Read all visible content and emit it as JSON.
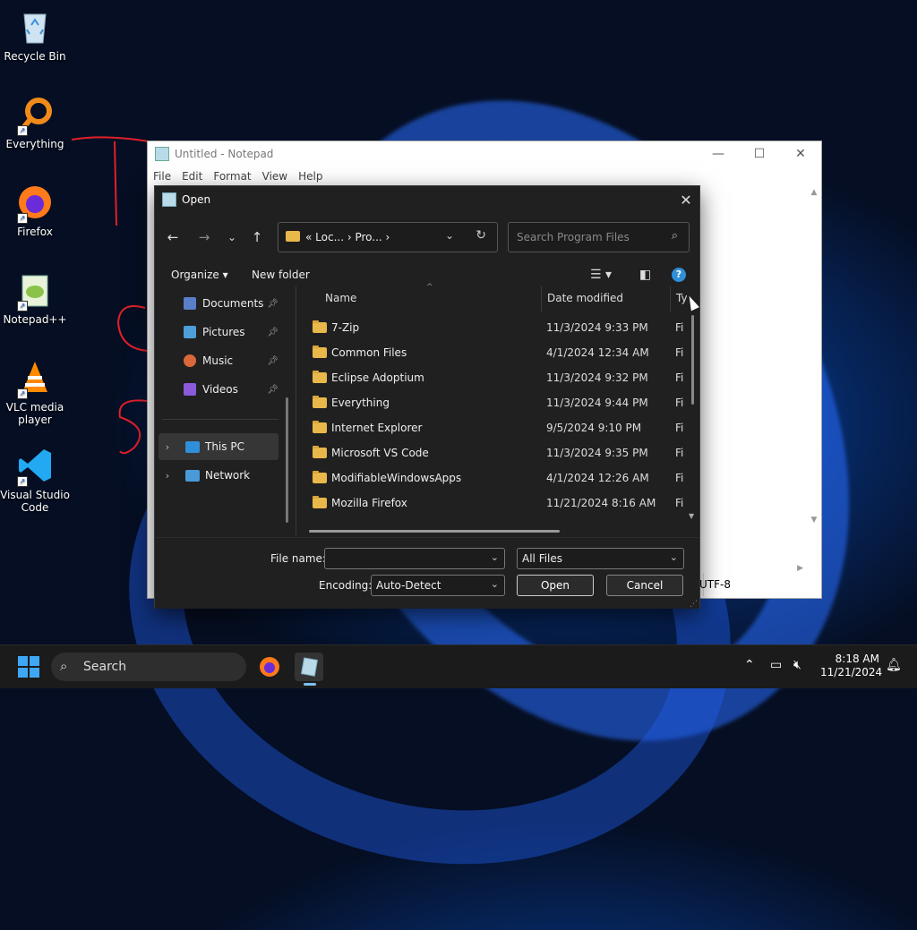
{
  "desktop": {
    "icons": [
      {
        "label": "Recycle Bin"
      },
      {
        "label": "Everything"
      },
      {
        "label": "Firefox"
      },
      {
        "label": "Notepad++"
      },
      {
        "label": "VLC media player"
      },
      {
        "label": "Visual Studio Code"
      }
    ]
  },
  "notepad": {
    "title": "Untitled - Notepad",
    "menu": [
      "File",
      "Edit",
      "Format",
      "View",
      "Help"
    ],
    "encoding_status": "UTF-8"
  },
  "dialog": {
    "title": "Open",
    "address": {
      "breadcrumb": "« Loc... › Pro... ›"
    },
    "search_placeholder": "Search Program Files",
    "organize_label": "Organize ▾",
    "new_folder_label": "New folder",
    "nav_items": [
      {
        "label": "Documents",
        "color": "#5a7fc9"
      },
      {
        "label": "Pictures",
        "color": "#4d9fd9"
      },
      {
        "label": "Music",
        "color": "#d9693a"
      },
      {
        "label": "Videos",
        "color": "#8a5ad9"
      }
    ],
    "tree": [
      {
        "label": "This PC",
        "selected": true
      },
      {
        "label": "Network",
        "selected": false
      }
    ],
    "columns": {
      "name": "Name",
      "date": "Date modified",
      "type": "Ty"
    },
    "rows": [
      {
        "name": "7-Zip",
        "date": "11/3/2024 9:33 PM",
        "type": "Fi"
      },
      {
        "name": "Common Files",
        "date": "4/1/2024 12:34 AM",
        "type": "Fi"
      },
      {
        "name": "Eclipse Adoptium",
        "date": "11/3/2024 9:32 PM",
        "type": "Fi"
      },
      {
        "name": "Everything",
        "date": "11/3/2024 9:44 PM",
        "type": "Fi"
      },
      {
        "name": "Internet Explorer",
        "date": "9/5/2024 9:10 PM",
        "type": "Fi"
      },
      {
        "name": "Microsoft VS Code",
        "date": "11/3/2024 9:35 PM",
        "type": "Fi"
      },
      {
        "name": "ModifiableWindowsApps",
        "date": "4/1/2024 12:26 AM",
        "type": "Fi"
      },
      {
        "name": "Mozilla Firefox",
        "date": "11/21/2024 8:16 AM",
        "type": "Fi"
      }
    ],
    "file_name_label": "File name:",
    "file_name_value": "",
    "file_type_value": "All Files",
    "encoding_label": "Encoding:",
    "encoding_value": "Auto-Detect",
    "open_label": "Open",
    "cancel_label": "Cancel"
  },
  "taskbar": {
    "search_label": "Search",
    "time": "8:18 AM",
    "date": "11/21/2024"
  }
}
